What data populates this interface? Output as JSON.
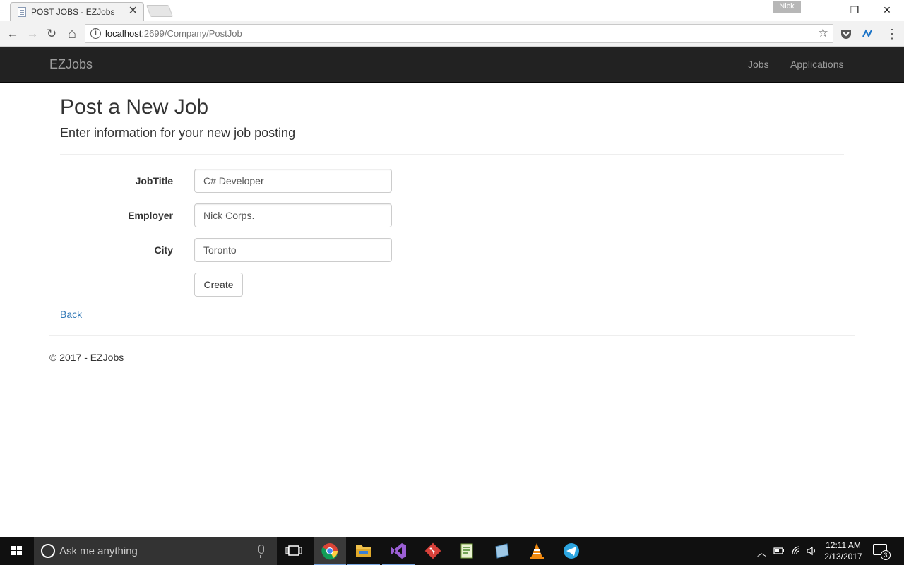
{
  "browser": {
    "tab_title": "POST JOBS - EZJobs",
    "tab_close": "✕",
    "profile_name": "Nick",
    "window_minimize": "—",
    "window_restore": "❐",
    "window_close": "✕",
    "url_host": "localhost",
    "url_path": ":2699/Company/PostJob",
    "nav_back": "←",
    "nav_forward": "→",
    "nav_reload": "↻",
    "nav_home": "⌂",
    "bookmark_star": "☆"
  },
  "navbar": {
    "brand": "EZJobs",
    "links": [
      "Jobs",
      "Applications"
    ]
  },
  "page": {
    "title": "Post a New Job",
    "subtitle": "Enter information for your new job posting"
  },
  "form": {
    "fields": [
      {
        "label": "JobTitle",
        "value": "C# Developer"
      },
      {
        "label": "Employer",
        "value": "Nick Corps."
      },
      {
        "label": "City",
        "value": "Toronto"
      }
    ],
    "submit_label": "Create"
  },
  "back_link": "Back",
  "footer": "© 2017 - EZJobs",
  "taskbar": {
    "search_placeholder": "Ask me anything",
    "time": "12:11 AM",
    "date": "2/13/2017",
    "notification_count": "3"
  },
  "colors": {
    "navbar_bg": "#222222",
    "link": "#337ab7",
    "taskbar_bg": "#101010"
  }
}
